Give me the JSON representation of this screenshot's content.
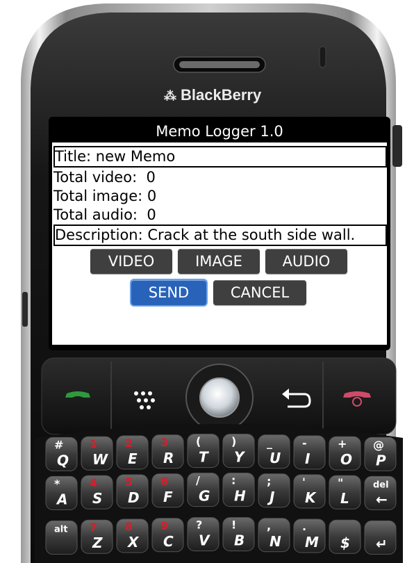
{
  "device": {
    "brand": "BlackBerry"
  },
  "app": {
    "title": "Memo Logger 1.0"
  },
  "form": {
    "title_label": "Title: new Memo",
    "video_label": "Total video:",
    "video_count": "0",
    "image_label": "Total image:",
    "image_count": "0",
    "audio_label": "Total audio:",
    "audio_count": "0",
    "description_label": "Description: Crack at the south side wall."
  },
  "buttons": {
    "video": "VIDEO",
    "image": "IMAGE",
    "audio": "AUDIO",
    "send": "SEND",
    "cancel": "CANCEL"
  },
  "colors": {
    "send_accent": "#2862b9",
    "button_dark": "#3f3f3f",
    "call_green": "#2e9a3e",
    "end_red": "#d04a6a"
  },
  "keyboard": {
    "row1": [
      {
        "sym": "#",
        "num": "",
        "letter": "Q"
      },
      {
        "sym": "",
        "num": "1",
        "letter": "W"
      },
      {
        "sym": "",
        "num": "2",
        "letter": "E"
      },
      {
        "sym": "",
        "num": "3",
        "letter": "R"
      },
      {
        "sym": "(",
        "num": "",
        "letter": "T"
      },
      {
        "sym": ")",
        "num": "",
        "letter": "Y"
      },
      {
        "sym": "_",
        "num": "",
        "letter": "U"
      },
      {
        "sym": "-",
        "num": "",
        "letter": "I"
      },
      {
        "sym": "+",
        "num": "",
        "letter": "O"
      },
      {
        "sym": "@",
        "num": "",
        "letter": "P"
      }
    ],
    "row2": [
      {
        "sym": "*",
        "num": "",
        "letter": "A"
      },
      {
        "sym": "",
        "num": "4",
        "letter": "S"
      },
      {
        "sym": "",
        "num": "5",
        "letter": "D"
      },
      {
        "sym": "",
        "num": "6",
        "letter": "F"
      },
      {
        "sym": "/",
        "num": "",
        "letter": "G"
      },
      {
        "sym": ":",
        "num": "",
        "letter": "H"
      },
      {
        "sym": ";",
        "num": "",
        "letter": "J"
      },
      {
        "sym": "'",
        "num": "",
        "letter": "K"
      },
      {
        "sym": "\"",
        "num": "",
        "letter": "L"
      },
      {
        "sym": "del",
        "num": "",
        "letter": "←"
      }
    ],
    "row3": [
      {
        "sym": "alt",
        "num": "",
        "letter": ""
      },
      {
        "sym": "",
        "num": "7",
        "letter": "Z"
      },
      {
        "sym": "",
        "num": "8",
        "letter": "X"
      },
      {
        "sym": "",
        "num": "9",
        "letter": "C"
      },
      {
        "sym": "?",
        "num": "",
        "letter": "V"
      },
      {
        "sym": "!",
        "num": "",
        "letter": "B"
      },
      {
        "sym": ",",
        "num": "",
        "letter": "N"
      },
      {
        "sym": ".",
        "num": "",
        "letter": "M"
      },
      {
        "sym": "",
        "num": "",
        "letter": "$"
      },
      {
        "sym": "",
        "num": "",
        "letter": "↵"
      }
    ]
  }
}
